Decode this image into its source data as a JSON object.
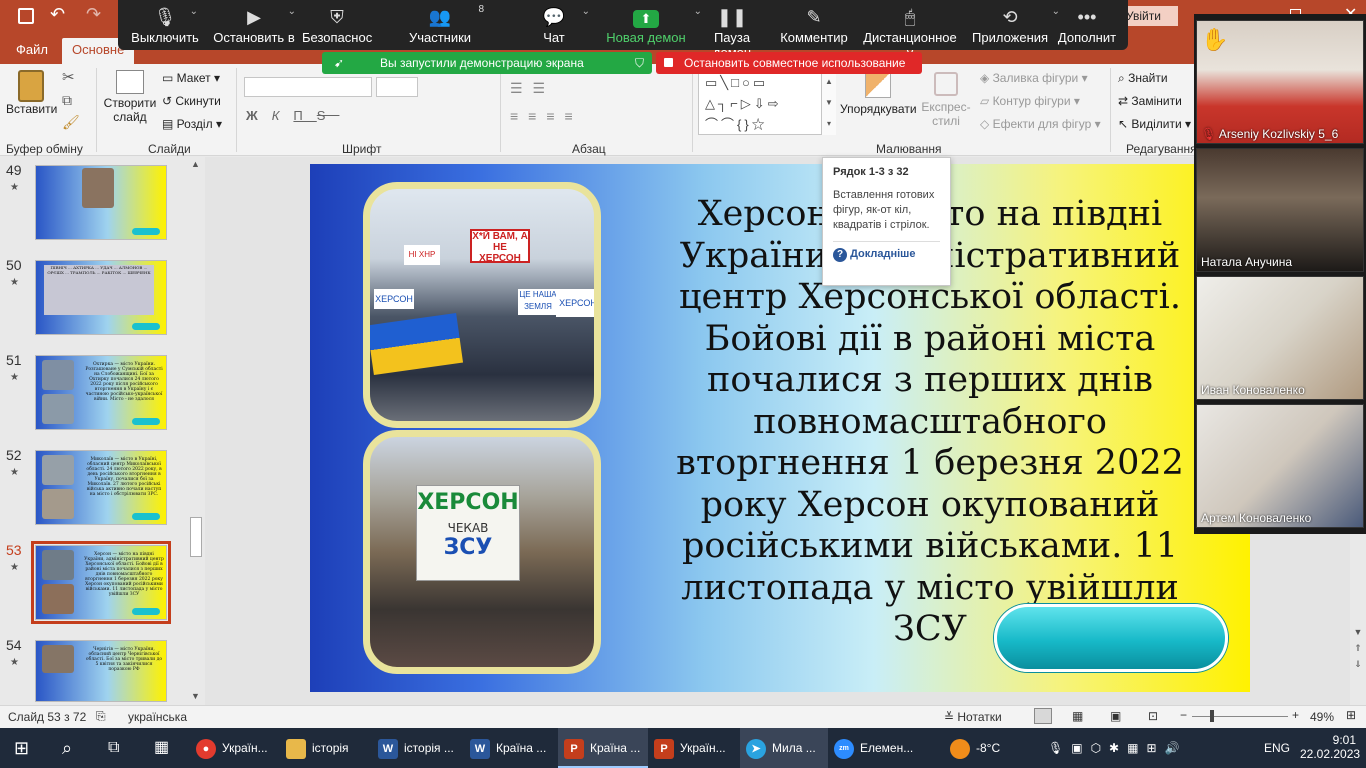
{
  "titlebar": {
    "right_btn": "Увійти"
  },
  "ppt_tabs": [
    {
      "label": "Файл"
    },
    {
      "label": "Основне"
    }
  ],
  "ribbon": {
    "paste": "Вставити",
    "clipboard_group": "Буфер обміну",
    "new_slide_l1": "Створити",
    "new_slide_l2": "слайд",
    "layout": "Макет",
    "reset": "Скинути",
    "section": "Розділ",
    "slides_group": "Слайди",
    "font_group": "Шрифт",
    "font_btns": [
      "Ж",
      "К",
      "П",
      "S"
    ],
    "para_group": "Абзац",
    "arrange": "Упорядкувати",
    "quick_styles_l1": "Експрес-",
    "quick_styles_l2": "стилі",
    "fill": "Заливка фігури",
    "outline": "Контур фігури",
    "effects": "Ефекти для фігур",
    "drawing_group": "Малювання",
    "find": "Знайти",
    "replace": "Замінити",
    "select": "Виділити",
    "editing_group": "Редагування"
  },
  "zoom": {
    "items": [
      {
        "label": "Выключить",
        "icon": "mic-icon"
      },
      {
        "label": "Остановить в",
        "icon": "video-icon"
      },
      {
        "label": "Безопаснос",
        "icon": "shield-icon"
      },
      {
        "label": "Участники",
        "icon": "participants-icon",
        "count": "8"
      },
      {
        "label": "Чат",
        "icon": "chat-icon"
      },
      {
        "label": "Новая демон",
        "icon": "share-icon"
      },
      {
        "label": "Пауза демон",
        "icon": "pause-icon"
      },
      {
        "label": "Комментир",
        "icon": "pen-icon"
      },
      {
        "label": "Дистанционное у",
        "icon": "mouse-icon"
      },
      {
        "label": "Приложения",
        "icon": "apps-icon"
      },
      {
        "label": "Дополнит",
        "icon": "more-icon"
      }
    ],
    "share_banner": "Вы запустили демонстрацию экрана",
    "stop_share": "Остановить совместное использование",
    "accent": "#23a844",
    "stop_color": "#e02828"
  },
  "thumbnails": [
    {
      "num": "49",
      "text": ""
    },
    {
      "num": "50",
      "text": "ПІВНІЧ ... АХТИРКА ... УДАЧ ... АЛМОНОВ ... ОРЄШХ ... ТРАМПОЛЬ ... РАКІТОК ... ШЕВЧЕНК"
    },
    {
      "num": "51",
      "text": "Охтирка — місто України. Розташоване у Сумській області на Слобожанщині. Бої за Охтирку почалися 24 лютого 2022 року після російського вторгнення в Україну і є частиною російсько-української війни. Місто - не здалося"
    },
    {
      "num": "52",
      "text": "Миколаїв — місто в Україні, обласний центр Миколаївської області. 24 лютого 2022 року, в день російського вторгнення в Україну, почалися бої за Миколаїв. 27 лютого російські війська активно почали наступ на місто і обстрілювати ЗРС."
    },
    {
      "num": "53",
      "text": "Херсон — місто на півдні України, адміністративний центр Херсонської області. Бойові дії в районі міста почалися з перших днів повномасштабного вторгнення 1 березня 2022 року Херсон окупований російськими військами. 11 листопада у місто увійшли ЗСУ"
    },
    {
      "num": "54",
      "text": "Чернігів — місто України, обласний центр Чернігівської області. Бої за місто тривали до 5 квітня та закінчилися поразкою РФ"
    }
  ],
  "slide": {
    "text": "Херсон — місто на півдні України, адміністративний центр Херсонської області. Бойові дії в районі міста почалися з перших днів повномасштабного вторгнення 1 березня 2022 року Херсон окупований російськими військами. 11 листопада у місто увійшли ЗСУ",
    "photo1_signs": [
      "Х*Й ВАМ, А НЕ ХЕРСОН",
      "ХЕРСОН",
      "ЦЕ НАША ЗЕМЛЯ",
      "ХЕРСОН",
      "НІ ХНР"
    ],
    "photo2_sign_l1": "ХЕРСОН",
    "photo2_sign_l2": "ЧЕКАВ",
    "photo2_sign_l3": "ЗСУ"
  },
  "tooltip": {
    "title": "Рядок 1-3 з 32",
    "body": "Вставлення готових фігур, як-от кіл, квадратів і стрілок.",
    "more": "Докладніше"
  },
  "videos": [
    {
      "name": "Arseniy Kozlivskiy 5_6",
      "muted": true
    },
    {
      "name": "Натала Анучина",
      "muted": false
    },
    {
      "name": "Иван Коноваленко",
      "muted": false
    },
    {
      "name": "Артем Коноваленко",
      "muted": false
    }
  ],
  "status": {
    "slide": "Слайд 53 з 72",
    "lang": "українська",
    "notes": "Нотатки",
    "zoom": "49%"
  },
  "taskbar": {
    "apps": [
      {
        "label": "Україн...",
        "color": "#e33b2e"
      },
      {
        "label": "історія",
        "color": "#e8b84a"
      },
      {
        "label": "історія ...",
        "color": "#2b579a"
      },
      {
        "label": "Країна ...",
        "color": "#2b579a"
      },
      {
        "label": "Країна ...",
        "color": "#c43e1c"
      },
      {
        "label": "Україн...",
        "color": "#c43e1c"
      },
      {
        "label": "Мила ...",
        "color": "#2aa3e0"
      },
      {
        "label": "Елемен...",
        "color": "#2d8cff"
      }
    ],
    "temp": "-8°C",
    "lang": "ENG",
    "time": "9:01",
    "date": "22.02.2023"
  }
}
